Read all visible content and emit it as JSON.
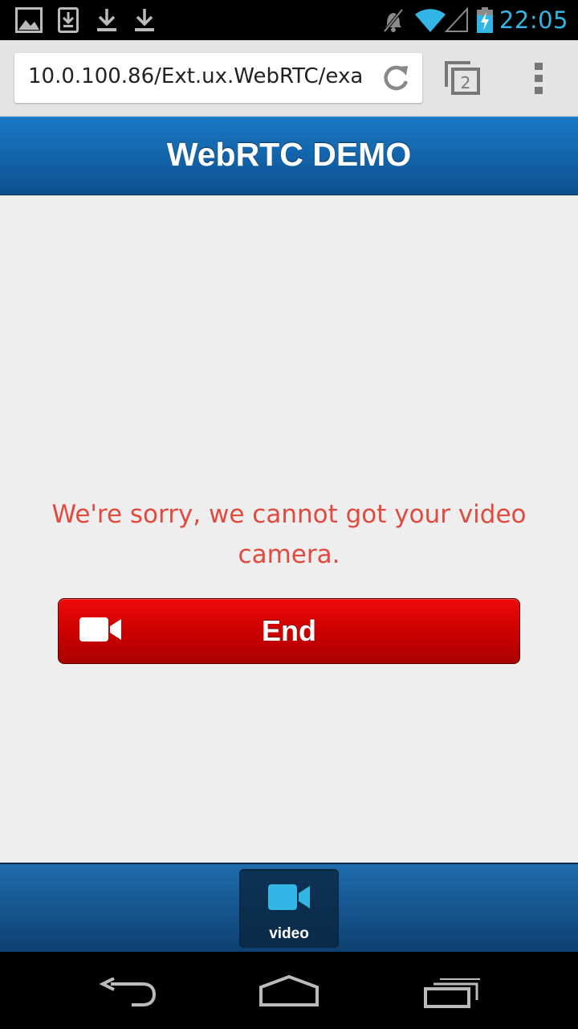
{
  "status_bar": {
    "time": "22:05",
    "notification_icons": [
      "gallery-icon",
      "download-box-icon",
      "download-icon",
      "download-icon"
    ],
    "system_icons": [
      "mute-icon",
      "wifi-icon",
      "signal-icon",
      "battery-charging-icon"
    ],
    "clock_color": "#33b5e5"
  },
  "browser": {
    "url": "10.0.100.86/Ext.ux.WebRTC/exa",
    "tab_count": "2"
  },
  "app": {
    "title": "WebRTC DEMO",
    "header_color": "#1566ab"
  },
  "content": {
    "error_message": "We're sorry, we cannot got your video camera.",
    "error_color": "#e04a3f",
    "end_button_label": "End",
    "end_button_icon": "video-camera-icon",
    "end_button_color": "#d40000"
  },
  "tab_bar": {
    "items": [
      {
        "label": "video",
        "icon": "video-camera-icon",
        "active": true,
        "icon_color": "#33b5e5"
      }
    ]
  },
  "nav_bar": {
    "buttons": [
      "back-icon",
      "home-icon",
      "recent-apps-icon"
    ]
  }
}
